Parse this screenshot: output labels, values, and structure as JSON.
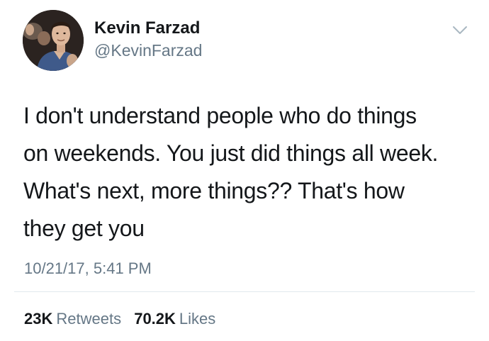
{
  "author": {
    "name": "Kevin Farzad",
    "handle": "@KevinFarzad"
  },
  "tweet": {
    "lines": [
      "I don't understand people who do things",
      "on weekends. You just did things all week.",
      "What's next, more things?? That's how",
      "they get you"
    ],
    "timestamp": "10/21/17, 5:41 PM"
  },
  "stats": {
    "retweets_count": "23K",
    "retweets_label": "Retweets",
    "likes_count": "70.2K",
    "likes_label": "Likes"
  },
  "icons": {
    "menu": "chevron-down-icon"
  },
  "colors": {
    "primary_text": "#14171a",
    "secondary_text": "#657786",
    "divider": "#e1e8ed"
  }
}
